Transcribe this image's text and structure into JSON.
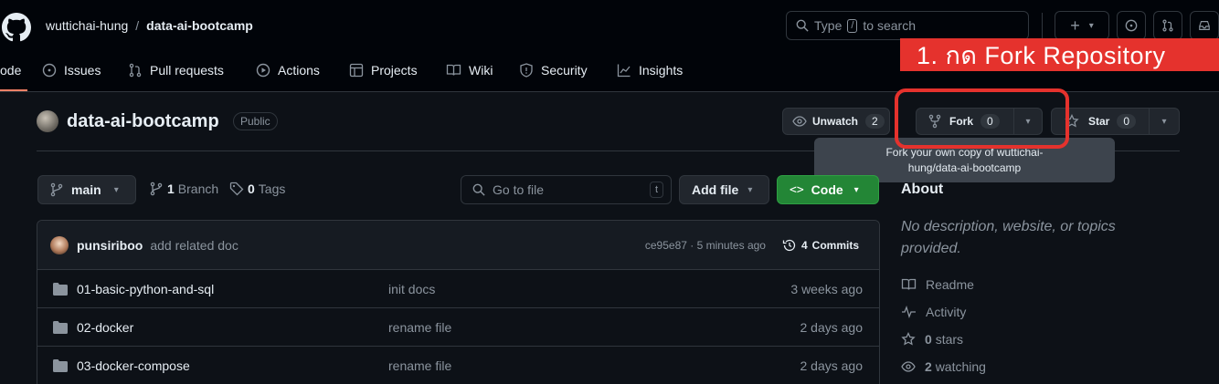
{
  "header": {
    "owner": "wuttichai-hung",
    "separator": "/",
    "repo": "data-ai-bootcamp",
    "search_placeholder": "Type  to search",
    "search_text_type": "Type",
    "search_key": "/",
    "search_text_rest": "to search"
  },
  "tabs": [
    {
      "label": "ode"
    },
    {
      "label": "Issues"
    },
    {
      "label": "Pull requests"
    },
    {
      "label": "Actions"
    },
    {
      "label": "Projects"
    },
    {
      "label": "Wiki"
    },
    {
      "label": "Security"
    },
    {
      "label": "Insights"
    }
  ],
  "annotation": {
    "text": "1. กด Fork Repository",
    "color": "#e5322d"
  },
  "repo": {
    "name": "data-ai-bootcamp",
    "visibility": "Public",
    "unwatch_label": "Unwatch",
    "unwatch_count": "2",
    "fork_label": "Fork",
    "fork_count": "0",
    "star_label": "Star",
    "star_count": "0"
  },
  "tooltip": {
    "line1": "Fork your own copy of wuttichai-",
    "line2": "hung/data-ai-bootcamp"
  },
  "toolbar": {
    "branch": "main",
    "branches_count": "1",
    "branches_label": "Branch",
    "tags_count": "0",
    "tags_label": "Tags",
    "goto_placeholder": "Go to file",
    "goto_key": "t",
    "add_file": "Add file",
    "code": "Code"
  },
  "commit": {
    "author": "punsiriboo",
    "message": "add related doc",
    "hash_time": "ce95e87 · 5 minutes ago",
    "commits_count": "4",
    "commits_label": "Commits"
  },
  "files": [
    {
      "name": "01-basic-python-and-sql",
      "message": "init docs",
      "time": "3 weeks ago"
    },
    {
      "name": "02-docker",
      "message": "rename file",
      "time": "2 days ago"
    },
    {
      "name": "03-docker-compose",
      "message": "rename file",
      "time": "2 days ago"
    }
  ],
  "about": {
    "title": "About",
    "description": "No description, website, or topics provided.",
    "readme": "Readme",
    "activity": "Activity",
    "stars_count": "0",
    "stars_label": "stars",
    "watching_count": "2",
    "watching_label": "watching"
  },
  "colors": {
    "accent_green": "#238636",
    "highlight_red": "#e5322d",
    "active_tab": "#f78166"
  }
}
